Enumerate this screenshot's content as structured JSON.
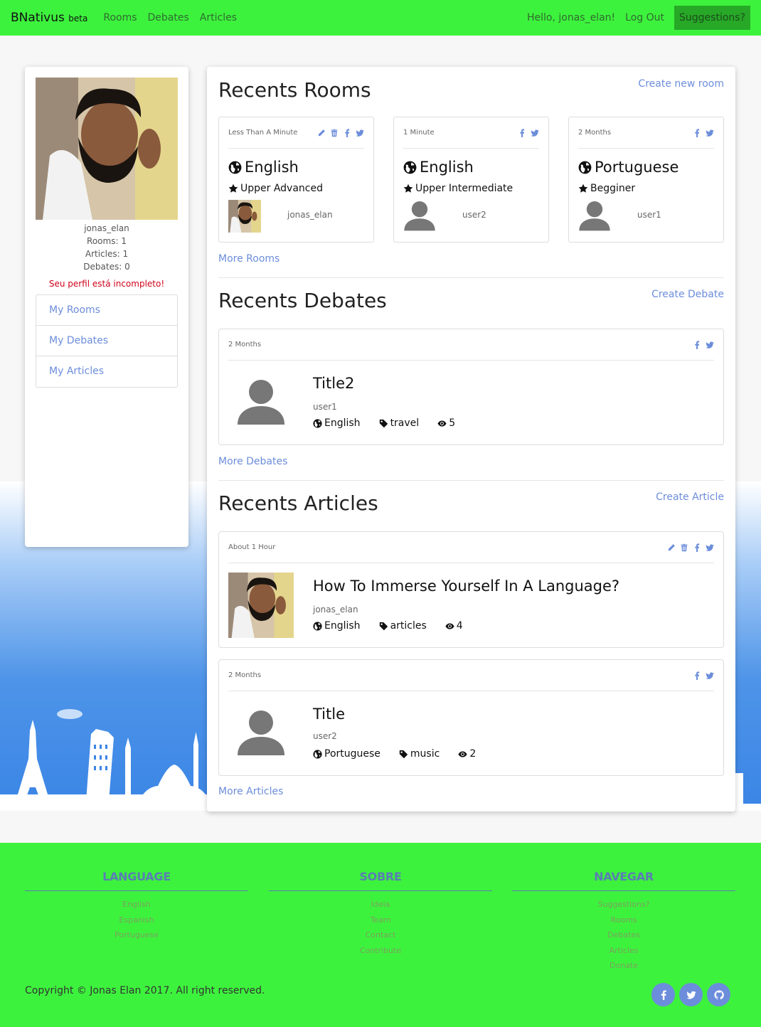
{
  "nav": {
    "brand": "BNativus",
    "brand_tag": "beta",
    "links": [
      "Rooms",
      "Debates",
      "Articles"
    ],
    "greeting": "Hello, jonas_elan!",
    "logout": "Log Out",
    "suggestions": "Suggestions?"
  },
  "profile": {
    "username": "jonas_elan",
    "rooms": "Rooms: 1",
    "articles": "Articles: 1",
    "debates": "Debates: 0",
    "warning": "Seu perfil está incompleto!",
    "menu": [
      "My Rooms",
      "My Debates",
      "My Articles"
    ]
  },
  "rooms": {
    "title": "Recents Rooms",
    "action": "Create new room",
    "more": "More Rooms",
    "items": [
      {
        "time": "Less Than A Minute",
        "language": "English",
        "level": "Upper Advanced",
        "owner": "jonas_elan"
      },
      {
        "time": "1 Minute",
        "language": "English",
        "level": "Upper Intermediate",
        "owner": "user2"
      },
      {
        "time": "2 Months",
        "language": "Portuguese",
        "level": "Begginer",
        "owner": "user1"
      }
    ]
  },
  "debates": {
    "title": "Recents Debates",
    "action": "Create Debate",
    "more": "More Debates",
    "items": [
      {
        "time": "2 Months",
        "title": "Title2",
        "author": "user1",
        "language": "English",
        "tag": "travel",
        "views": "5"
      }
    ]
  },
  "articles": {
    "title": "Recents Articles",
    "action": "Create Article",
    "more": "More Articles",
    "items": [
      {
        "time": "About 1 Hour",
        "title": "How To Immerse Yourself In A Language?",
        "author": "jonas_elan",
        "language": "English",
        "tag": "articles",
        "views": "4"
      },
      {
        "time": "2 Months",
        "title": "Title",
        "author": "user2",
        "language": "Portuguese",
        "tag": "music",
        "views": "2"
      }
    ]
  },
  "footer": {
    "language": {
      "title": "LANGUAGE",
      "items": [
        "English",
        "Espanish",
        "Portuguese"
      ]
    },
    "sobre": {
      "title": "SOBRE",
      "items": [
        "Ideia",
        "Team",
        "Contact",
        "Contribute"
      ]
    },
    "navegar": {
      "title": "NAVEGAR",
      "items": [
        "Suggestions?",
        "Rooms",
        "Debates",
        "Articles",
        "Donate"
      ]
    },
    "copyright": "Copyright © Jonas Elan 2017. All right reserved."
  },
  "colors": {
    "nav": "#3df23d",
    "link": "#6c8ddb",
    "warning": "#d0021b"
  }
}
